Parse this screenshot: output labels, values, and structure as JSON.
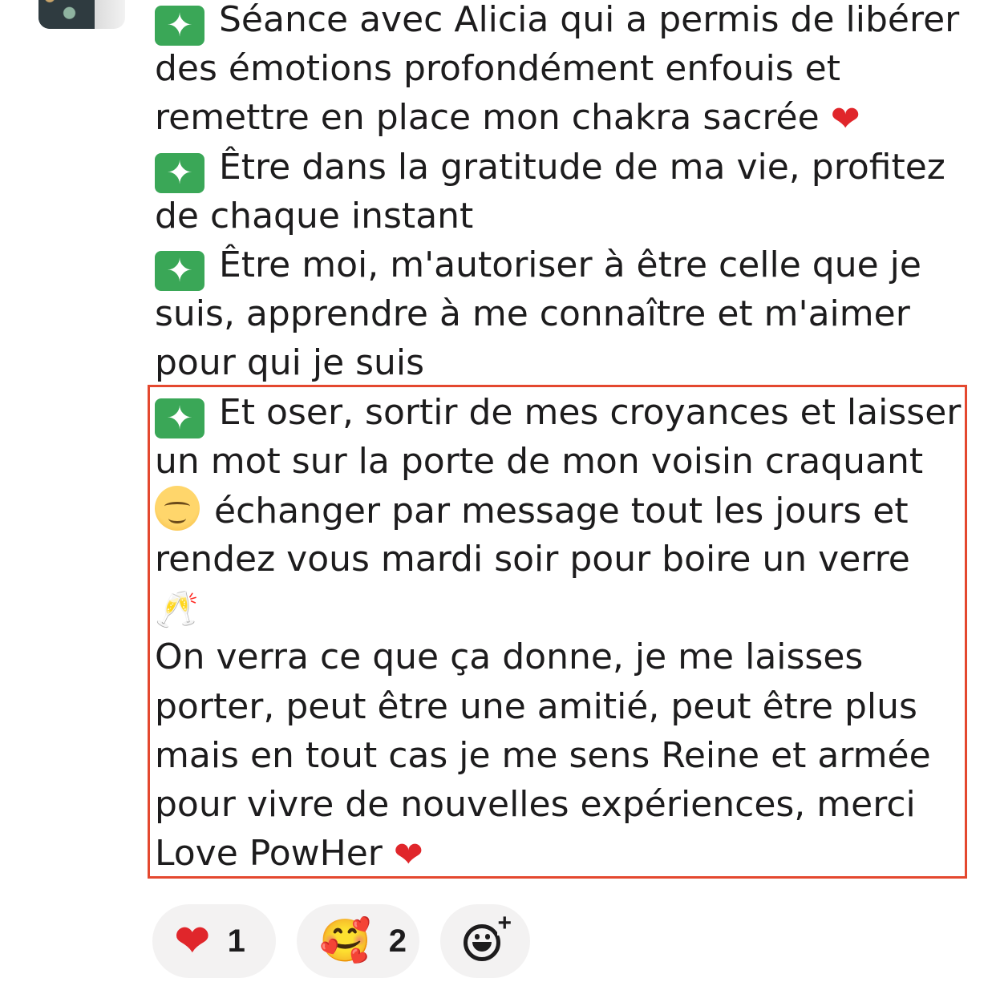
{
  "message": {
    "lines": [
      {
        "emoji": "✦",
        "text": "Séance avec Alicia qui a permis de libérer"
      },
      {
        "text": "des émotions profondément enfouis et"
      },
      {
        "text": "remettre en place mon chakra sacrée",
        "trail": "❤"
      },
      {
        "emoji": "✦",
        "text": "Être dans la gratitude de ma vie, profitez"
      },
      {
        "text": "de chaque instant"
      },
      {
        "emoji": "✦",
        "text": "Être moi, m'autoriser à être celle que je"
      },
      {
        "text": "suis, apprendre à me connaître et m'aimer"
      },
      {
        "text": "pour qui je suis"
      },
      {
        "emoji": "✦",
        "text": "Et oser, sortir de mes croyances et laisser"
      },
      {
        "text": "un mot sur la porte de mon voisin craquant"
      },
      {
        "lead": "smile",
        "text": "échanger par message tout les jours et"
      },
      {
        "text": "rendez vous mardi soir pour boire un verre"
      },
      {
        "text": "🥂"
      },
      {
        "text": "On verra ce que ça donne, je me laisses"
      },
      {
        "text": "porter, peut être une amitié, peut être plus"
      },
      {
        "text": "mais en tout cas je me sens Reine et armée"
      },
      {
        "text": "pour vivre de nouvelles expériences, merci"
      },
      {
        "text": "Love PowHer",
        "trail": "❤"
      }
    ]
  },
  "reactions": [
    {
      "emoji": "heart",
      "glyph": "❤",
      "count": "1"
    },
    {
      "emoji": "smiling-face-with-hearts",
      "glyph": "🥰",
      "count": "2"
    }
  ],
  "add_reaction": {
    "icon": "add-reaction-icon",
    "plus": "+"
  },
  "colors": {
    "highlight": "#e4482f",
    "sparkle_bg": "#3aa757",
    "heart": "#e0262b",
    "pill_bg": "#f3f2f2"
  }
}
